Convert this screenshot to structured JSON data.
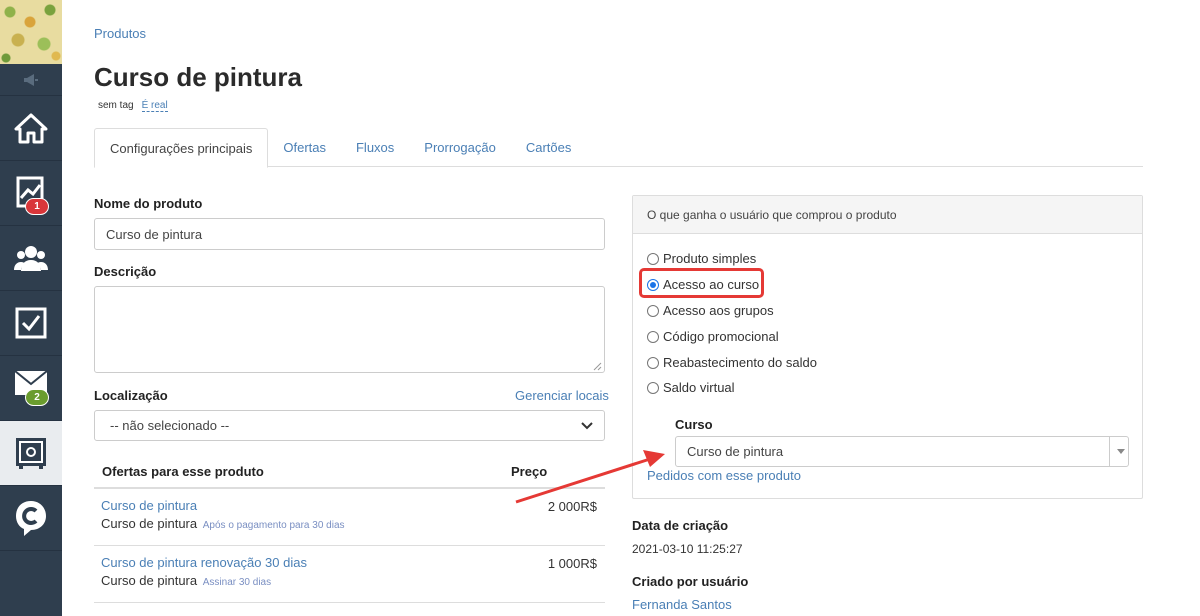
{
  "sidebar": {
    "items": [
      {
        "name": "home-icon"
      },
      {
        "name": "chart-icon",
        "badge": "1"
      },
      {
        "name": "users-icon"
      },
      {
        "name": "checkbox-icon"
      },
      {
        "name": "mail-icon",
        "badge": "2"
      },
      {
        "name": "safe-icon"
      },
      {
        "name": "chat-icon"
      }
    ]
  },
  "breadcrumb": "Produtos",
  "title": "Curso de pintura",
  "tags": {
    "no_tag": "sem tag",
    "real": "É real"
  },
  "tabs": [
    "Configurações principais",
    "Ofertas",
    "Fluxos",
    "Prorrogação",
    "Cartões"
  ],
  "form": {
    "name_label": "Nome do produto",
    "name_value": "Curso de pintura",
    "desc_label": "Descrição",
    "desc_value": "",
    "location_label": "Localização",
    "location_link": "Gerenciar locais",
    "location_value": "-- não selecionado --"
  },
  "offers": {
    "header_name": "Ofertas para esse produto",
    "header_price": "Preço",
    "rows": [
      {
        "name": "Curso de pintura",
        "sub": "Curso de pintura",
        "note": "Após o pagamento para 30 dias",
        "price": "2 000R$"
      },
      {
        "name": "Curso de pintura renovação 30 dias",
        "sub": "Curso de pintura",
        "note": "Assinar 30 dias",
        "price": "1 000R$"
      }
    ]
  },
  "panel": {
    "title": "O que ganha o usuário que comprou o produto",
    "options": [
      "Produto simples",
      "Acesso ao curso",
      "Acesso aos grupos",
      "Código promocional",
      "Reabastecimento do saldo",
      "Saldo virtual"
    ],
    "selected_index": 1,
    "course_label": "Curso",
    "course_value": "Curso de pintura",
    "orders_link": "Pedidos com esse produto"
  },
  "meta": {
    "created_label": "Data de criação",
    "created_value": "2021-03-10 11:25:27",
    "creator_label": "Criado por usuário",
    "creator_value": "Fernanda Santos"
  },
  "colors": {
    "accent": "#4a7fb5",
    "sidebar": "#2f3e4e",
    "annotation": "#e53935"
  }
}
